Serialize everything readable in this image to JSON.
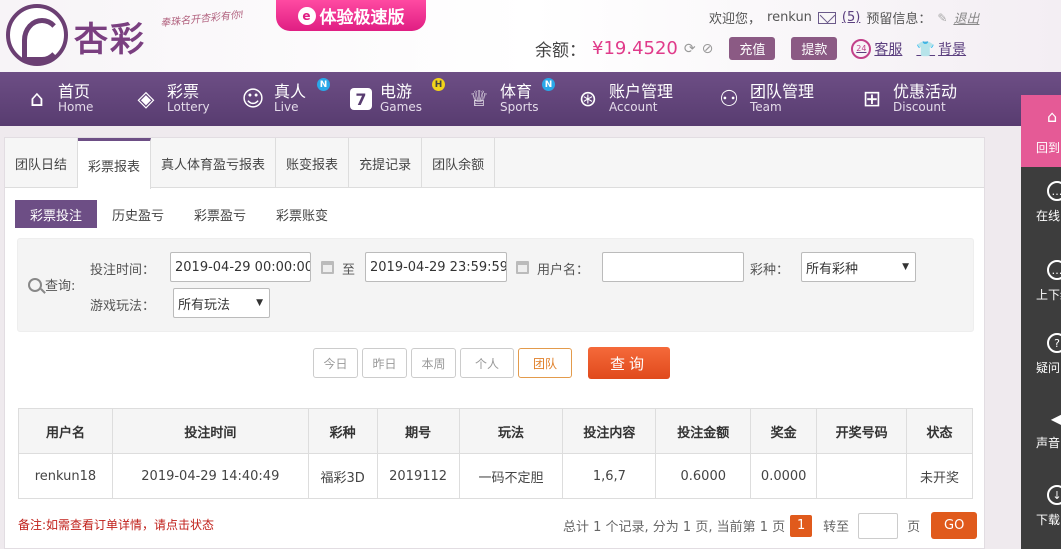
{
  "header": {
    "brand": "杏彩",
    "slogan": "奉珠名开杏彩有你!",
    "fast_version": "体验极速版",
    "welcome": "欢迎您，",
    "username": "renkun",
    "mail_count": "(5)",
    "reserve_label": "预留信息：",
    "logout": "退出",
    "balance_label": "余额：",
    "balance_value": "¥19.4520",
    "deposit": "充值",
    "withdraw": "提款",
    "service_badge": "24",
    "service": "客服",
    "background": "背景"
  },
  "nav": [
    {
      "cn": "首页",
      "en": "Home",
      "icon": "home-icon",
      "badge": ""
    },
    {
      "cn": "彩票",
      "en": "Lottery",
      "icon": "ticket-icon",
      "badge": ""
    },
    {
      "cn": "真人",
      "en": "Live",
      "icon": "dealer-icon",
      "badge": "N"
    },
    {
      "cn": "电游",
      "en": "Games",
      "icon": "slot-seven-icon",
      "badge": "H"
    },
    {
      "cn": "体育",
      "en": "Sports",
      "icon": "trophy-icon",
      "badge": "N"
    },
    {
      "cn": "账户管理",
      "en": "Account",
      "icon": "account-icon",
      "badge": ""
    },
    {
      "cn": "团队管理",
      "en": "Team",
      "icon": "team-icon",
      "badge": ""
    },
    {
      "cn": "优惠活动",
      "en": "Discount",
      "icon": "gift-icon",
      "badge": ""
    }
  ],
  "sidebar": {
    "top": "回到",
    "items": [
      "在线",
      "上下级",
      "疑问",
      "声音",
      "下载"
    ]
  },
  "tabs": [
    "团队日结",
    "彩票报表",
    "真人体育盈亏报表",
    "账变报表",
    "充提记录",
    "团队余额"
  ],
  "active_tab": "彩票报表",
  "subtabs": [
    "彩票投注",
    "历史盈亏",
    "彩票盈亏",
    "彩票账变"
  ],
  "active_subtab": "彩票投注",
  "search": {
    "query_label": "查询:",
    "time_label": "投注时间：",
    "start_time": "2019-04-29 00:00:00",
    "to": "至",
    "end_time": "2019-04-29 23:59:59",
    "user_label": "用户名：",
    "user_value": "",
    "lottery_label": "彩种：",
    "lottery_value": "所有彩种",
    "play_label": "游戏玩法：",
    "play_value": "所有玩法"
  },
  "quick": [
    "今日",
    "昨日",
    "本周",
    "个人",
    "团队"
  ],
  "active_quick": "团队",
  "query_button": "查询",
  "table": {
    "headers": [
      "用户名",
      "投注时间",
      "彩种",
      "期号",
      "玩法",
      "投注内容",
      "投注金额",
      "奖金",
      "开奖号码",
      "状态"
    ],
    "rows": [
      [
        "renkun18",
        "2019-04-29 14:40:49",
        "福彩3D",
        "2019112",
        "一码不定胆",
        "1,6,7",
        "0.6000",
        "0.0000",
        "",
        "未开奖"
      ]
    ]
  },
  "note": "备注:如需查看订单详情，请点击状态",
  "pager": {
    "summary": "总计 1 个记录, 分为 1 页, 当前第 1 页",
    "current": "1",
    "jump_label": "转至",
    "page_unit": "页",
    "go": "GO"
  },
  "colors": {
    "nav_bg": "#6d4e85",
    "accent_pink": "#e03a8a",
    "query_orange": "#e04a1c",
    "status_green": "#2a8a1a"
  }
}
